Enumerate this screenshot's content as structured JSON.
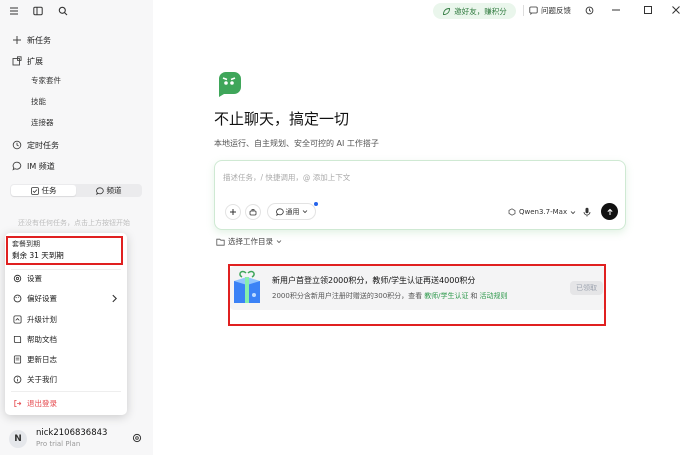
{
  "sidebar": {
    "new_task": "新任务",
    "extensions": "扩展",
    "ext_items": [
      "专家套件",
      "技能",
      "连接器"
    ],
    "scheduled": "定时任务",
    "im_channel": "IM 频道",
    "tabs": [
      "任务",
      "频道"
    ],
    "empty_hint": "还没有任何任务，点击上方按钮开始"
  },
  "popup": {
    "plan_title": "套餐到期",
    "plan_remaining": "剩余 31 天到期",
    "items": [
      "设置",
      "偏好设置",
      "升级计划",
      "帮助文档",
      "更新日志",
      "关于我们"
    ],
    "logout": "退出登录"
  },
  "user": {
    "initial": "N",
    "name": "nick2106836843",
    "plan": "Pro trial Plan"
  },
  "titlebar": {
    "invite": "邀好友，赚积分",
    "feedback": "问题反馈"
  },
  "main": {
    "heading": "不止聊天，搞定一切",
    "subheading": "本地运行、自主规划、安全可控的 AI 工作搭子",
    "input_placeholder": "描述任务，/ 快捷调用，@ 添加上下文",
    "mode": "通用",
    "model": "Qwen3.7-Max",
    "workspace": "选择工作目录",
    "banner_title": "新用户首登立领2000积分，教师/学生认证再送4000积分",
    "banner_desc": "2000积分含新用户注册时赠送的300积分，查看",
    "banner_link1": "教师/学生认证",
    "banner_and": "和",
    "banner_link2": "活动规则",
    "claimed": "已领取"
  },
  "colors": {
    "accent_green": "#3fa65a",
    "link_green": "#2f9a4d",
    "annotation_red": "#e02020",
    "logout_red": "#e5484d"
  }
}
